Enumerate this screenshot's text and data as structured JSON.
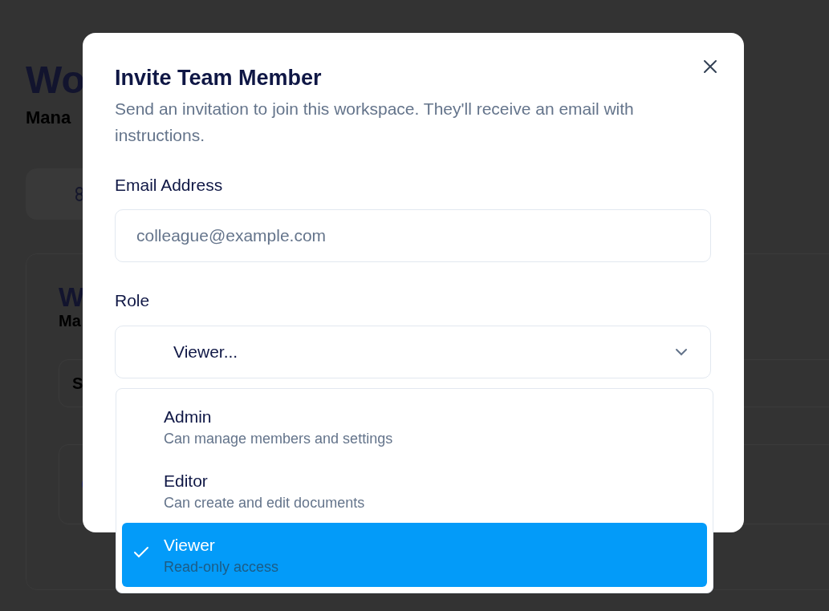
{
  "background": {
    "heading": "Wo",
    "subheading": "Mana",
    "card_title": "W",
    "card_subtitle": "Ma",
    "row_text": "S"
  },
  "dialog": {
    "title": "Invite Team Member",
    "description": "Send an invitation to join this workspace. They'll receive an email with instructions.",
    "email": {
      "label": "Email Address",
      "placeholder": "colleague@example.com"
    },
    "role": {
      "label": "Role",
      "value": "Viewer...",
      "expanded": true,
      "options": [
        {
          "label": "Admin",
          "description": "Can manage members and settings",
          "selected": false
        },
        {
          "label": "Editor",
          "description": "Can create and edit documents",
          "selected": false
        },
        {
          "label": "Viewer",
          "description": "Read-only access",
          "selected": true
        }
      ]
    }
  }
}
